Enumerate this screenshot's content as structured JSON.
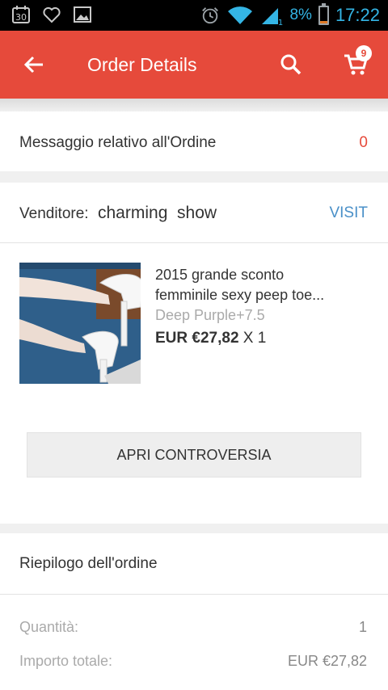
{
  "status_bar": {
    "calendar_day": "30",
    "battery_percent": "8%",
    "battery_level": 0.08,
    "time": "17:22",
    "signal_sim_label": "1",
    "accent_color": "#34b5e5"
  },
  "app_bar": {
    "title": "Order Details",
    "cart_count": "9",
    "color": "#e64a3b"
  },
  "order_message": {
    "label": "Messaggio relativo all'Ordine",
    "count": "0",
    "count_color": "#e64a3b"
  },
  "seller": {
    "label": "Venditore:",
    "name": "charming  show",
    "visit_label": "VISIT",
    "visit_color": "#4a90c8"
  },
  "product": {
    "title_line1": "2015 grande sconto",
    "title_line2": "femminile sexy peep toe...",
    "variant": "Deep Purple+7.5",
    "price": "EUR €27,82",
    "quantity": "X 1"
  },
  "dispute_button": {
    "label": "APRI CONTROVERSIA"
  },
  "summary": {
    "title": "Riepilogo dell'ordine",
    "rows": [
      {
        "label": "Quantità:",
        "value": "1"
      },
      {
        "label": "Importo totale:",
        "value": "EUR €27,82"
      }
    ]
  }
}
